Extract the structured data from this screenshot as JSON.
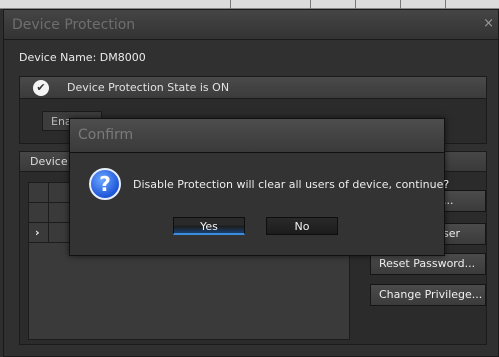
{
  "window": {
    "title": "Device Protection",
    "close": "×",
    "device_name": "Device Name: DM8000",
    "state_label": "Device Protection State is ON",
    "enable_button": "Ena",
    "device_group_label": "Device",
    "buttons": {
      "top": "...",
      "user": "ser",
      "reset_password": "Reset Password...",
      "change_privilege": "Change Privilege..."
    }
  },
  "dialog": {
    "title": "Confirm",
    "message": "Disable Protection will clear all users of device, continue?",
    "yes": "Yes",
    "no": "No"
  },
  "icons": {
    "check": "✔",
    "question": "?",
    "row_arrow": "›"
  },
  "colors": {
    "accent": "#3a8dde",
    "question_icon": "#1d56d8",
    "background": "#303030"
  }
}
